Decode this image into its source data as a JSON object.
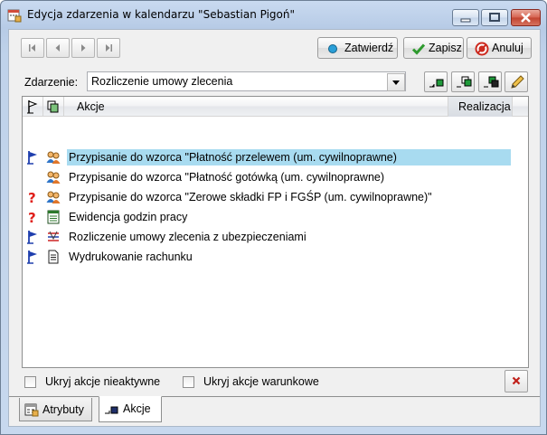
{
  "window": {
    "title": "Edycja zdarzenia w kalendarzu \"Sebastian Pigoń\""
  },
  "toolbar": {
    "approve_label": "Zatwierdź",
    "save_label": "Zapisz",
    "cancel_label": "Anuluj"
  },
  "event": {
    "label": "Zdarzenie:",
    "value": "Rozliczenie umowy zlecenia"
  },
  "grid": {
    "columns": [
      "Akcje",
      "Realizacja"
    ],
    "rows": [
      {
        "flag": "blue-flag-icon",
        "type": "people-icon",
        "label": "Przypisanie do wzorca \"Płatność przelewem (um. cywilnoprawne)",
        "selected": true
      },
      {
        "flag": "",
        "type": "people-icon",
        "label": "Przypisanie do wzorca \"Płatność gotówką (um. cywilnoprawne)",
        "selected": false
      },
      {
        "flag": "red-question-icon",
        "type": "people-icon",
        "label": "Przypisanie do wzorca \"Zerowe składki FP i FGŚP (um. cywilnoprawne)\"",
        "selected": false
      },
      {
        "flag": "red-question-icon",
        "type": "timesheet-icon",
        "label": "Ewidencja godzin pracy",
        "selected": false
      },
      {
        "flag": "blue-flag-icon",
        "type": "settlement-icon",
        "label": "Rozliczenie umowy zlecenia z ubezpieczeniami",
        "selected": false
      },
      {
        "flag": "blue-flag-icon",
        "type": "document-icon",
        "label": "Wydrukowanie rachunku",
        "selected": false
      }
    ]
  },
  "options": {
    "hide_inactive_label": "Ukryj akcje nieaktywne",
    "hide_conditional_label": "Ukryj akcje warunkowe"
  },
  "tabs": [
    {
      "label": "Atrybuty",
      "active": false
    },
    {
      "label": "Akcje",
      "active": true
    }
  ],
  "colors": {
    "selection": "#a8dbf0",
    "flag_blue": "#1f3fae",
    "question_red": "#e0201b",
    "approve_accent": "#2a9fd8",
    "save_accent": "#2e9a2e",
    "cancel_accent": "#cc2a1f"
  }
}
